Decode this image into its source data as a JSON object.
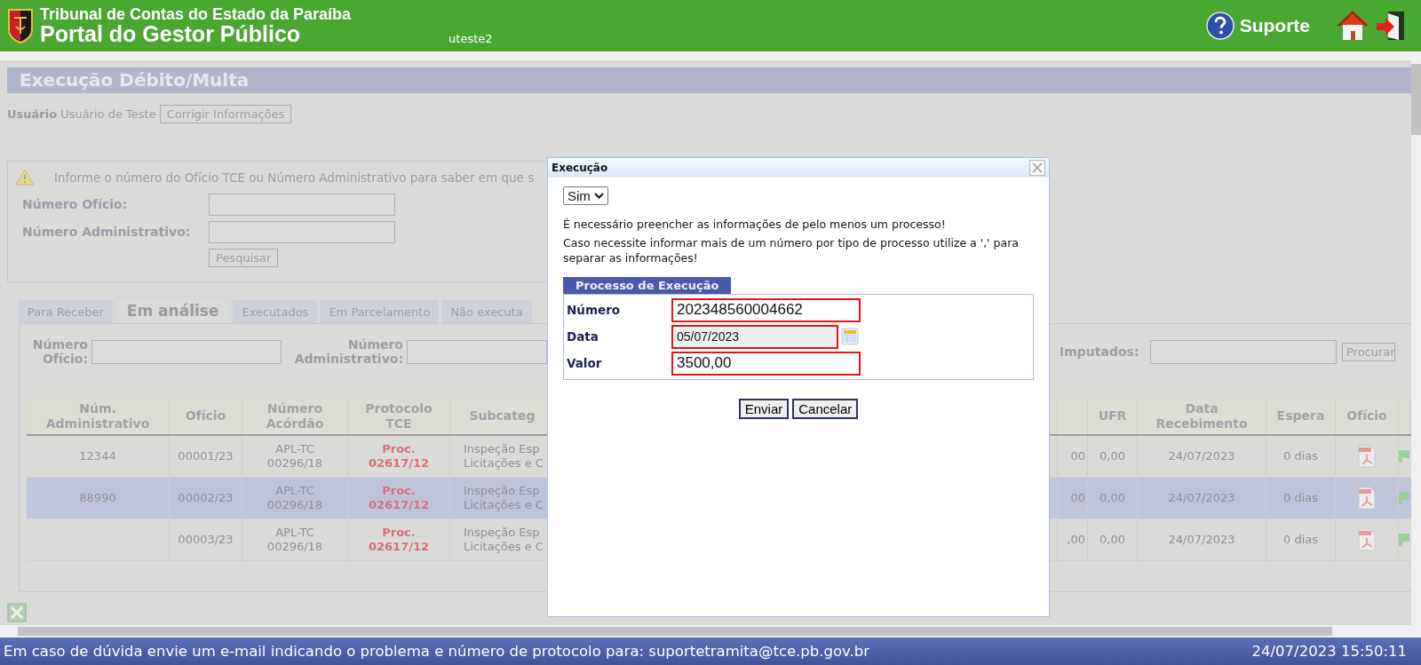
{
  "header": {
    "organization": "Tribunal de Contas do Estado da Paraíba",
    "portal": "Portal do Gestor Público",
    "username": "uteste2",
    "support": "Suporte"
  },
  "page": {
    "title": "Execução Débito/Multa",
    "user_label": "Usuário",
    "user_name": "Usuário de Teste",
    "edit_button": "Corrigir Informações"
  },
  "search_box": {
    "message": "Informe o número do Ofício TCE ou Número Administrativo para saber em que s",
    "fields": [
      {
        "label": "Número Ofício:"
      },
      {
        "label": "Número Administrativo:"
      }
    ],
    "button": "Pesquisar"
  },
  "tabs": [
    {
      "label": "Para Receber",
      "selected": false
    },
    {
      "label": "Em análise",
      "selected": true
    },
    {
      "label": "Executados",
      "selected": false
    },
    {
      "label": "Em Parcelamento",
      "selected": false
    },
    {
      "label": "Não executa",
      "selected": false
    }
  ],
  "filters": {
    "fields": [
      {
        "label": "Número\nOfício:"
      },
      {
        "label": "Número\nAdministrativo:"
      },
      {
        "label": "Imputados:"
      }
    ],
    "button": "Procurar"
  },
  "table": {
    "columns_left": [
      "Núm.\nAdministrativo",
      "Ofício",
      "Número\nAcórdão",
      "Protocolo\nTCE",
      "Subcateg"
    ],
    "columns_right": [
      "UFR",
      "Data\nRecebimento",
      "Espera",
      "Ofício"
    ],
    "rows": [
      {
        "num_adm": "12344",
        "oficio": "00001/23",
        "acordao": "APL-TC\n00296/18",
        "protocolo": "Proc.\n02617/12",
        "subcategoria": "Inspeção Esp\nLicitações e C",
        "column_6": "00",
        "ufr": "0,00",
        "data": "24/07/2023",
        "espera": "0 dias",
        "selected": false
      },
      {
        "num_adm": "88990",
        "oficio": "00002/23",
        "acordao": "APL-TC\n00296/18",
        "protocolo": "Proc.\n02617/12",
        "subcategoria": "Inspeção Esp\nLicitações e C",
        "column_6": "00",
        "ufr": "0,00",
        "data": "24/07/2023",
        "espera": "0 dias",
        "selected": true
      },
      {
        "oficio": "00003/23",
        "acordao": "APL-TC\n00296/18",
        "protocolo": "Proc.\n02617/12",
        "subcategoria": "Inspeção Esp\nLicitações e C",
        "column_6": ",00",
        "ufr": "0,00",
        "data": "24/07/2023",
        "espera": "0 dias",
        "selected": false
      }
    ]
  },
  "modal": {
    "title": "Execução",
    "select": "Sim",
    "messages": [
      "É necessário preencher as informações de pelo menos um processo!",
      "Caso necessite informar mais de um número por tipo de processo utilize a ',' para separar as informações!"
    ],
    "legend": "Processo de Execução",
    "fields": [
      {
        "label": "Número",
        "value": "202348560004662",
        "kind": "text",
        "invalid": true,
        "disabled": false
      },
      {
        "label": "Data",
        "value": "05/07/2023",
        "kind": "date",
        "invalid": true,
        "disabled": true
      },
      {
        "label": "Valor",
        "value": "3500,00",
        "kind": "text",
        "invalid": true,
        "disabled": false
      }
    ],
    "buttons": [
      "Enviar",
      "Cancelar"
    ]
  },
  "footer": {
    "message": "Em caso de dúvida envie um e-mail indicando o problema e número de protocolo para: suportetramita@tce.pb.gov.br",
    "datetime": "24/07/2023 15:50:11"
  }
}
